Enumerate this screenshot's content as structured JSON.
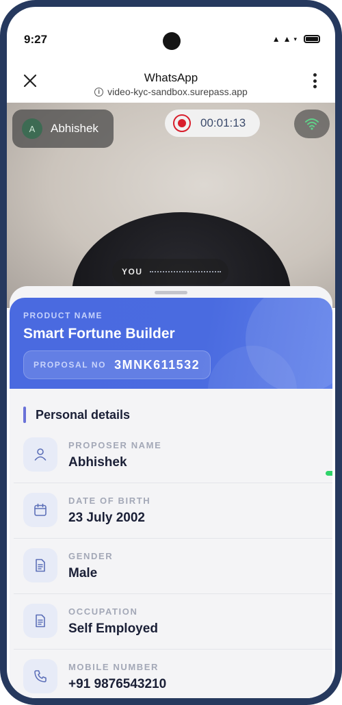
{
  "status_bar": {
    "time": "9:27"
  },
  "app_bar": {
    "title": "WhatsApp",
    "url": "video-kyc-sandbox.surepass.app"
  },
  "call": {
    "participant_initial": "A",
    "participant_name": "Abhishek",
    "recording_time": "00:01:13",
    "self_label": "YOU"
  },
  "product": {
    "label": "PRODUCT NAME",
    "name": "Smart Fortune Builder",
    "proposal_label": "PROPOSAL NO",
    "proposal_no": "3MNK611532"
  },
  "personal_details": {
    "title": "Personal details",
    "fields": [
      {
        "label": "PROPOSER NAME",
        "value": "Abhishek",
        "icon": "person-icon"
      },
      {
        "label": "DATE OF BIRTH",
        "value": "23 July 2002",
        "icon": "calendar-icon"
      },
      {
        "label": "GENDER",
        "value": "Male",
        "icon": "document-icon"
      },
      {
        "label": "OCCUPATION",
        "value": "Self Employed",
        "icon": "document-icon"
      },
      {
        "label": "MOBILE NUMBER",
        "value": "+91 9876543210",
        "icon": "phone-icon"
      }
    ]
  },
  "colors": {
    "frame": "#26395e",
    "card_blue": "#4a6ae0",
    "record_red": "#d81e2c",
    "accent": "#6a72d8"
  }
}
